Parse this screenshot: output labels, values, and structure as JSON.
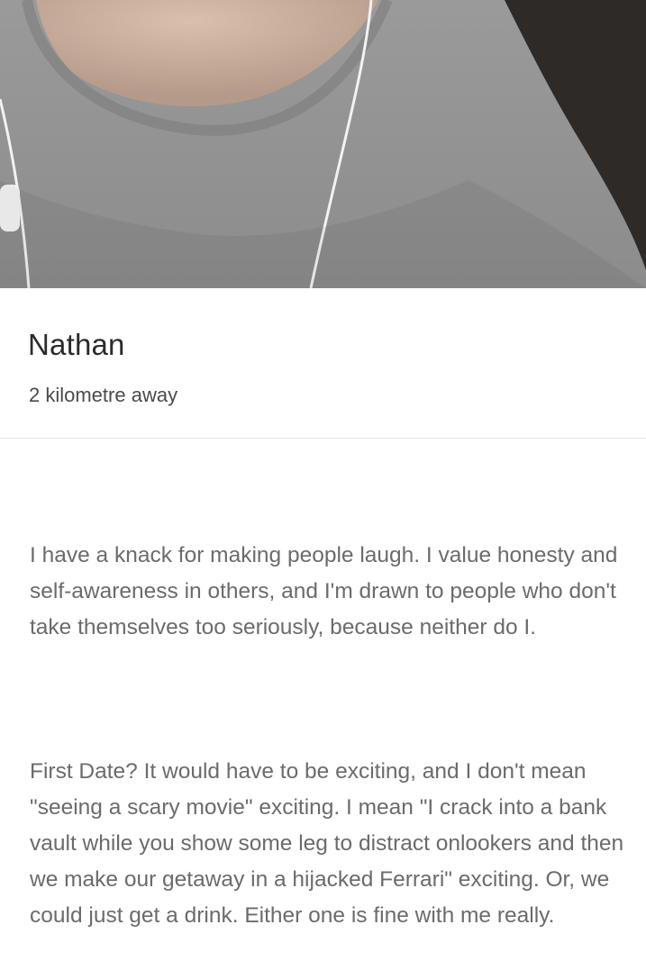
{
  "profile": {
    "photo_description_icon": "profile-photo",
    "name": "Nathan",
    "distance": "2 kilometre away",
    "bio_paragraphs": [
      "I have a knack for making people laugh. I value honesty and self-awareness in others, and I'm drawn to people who don't take themselves too seriously, because neither do I.",
      "First Date? It would have to be exciting, and I don't mean \"seeing a scary movie\" exciting. I mean \"I crack into a bank vault while you show some leg to distract onlookers and then we make our getaway in a hijacked Ferrari\" exciting. Or, we could just get a drink. Either one is fine with me really."
    ]
  },
  "colors": {
    "name_text": "#2b2b2b",
    "distance_text": "#4a4a4a",
    "bio_text": "#6b6b6b",
    "divider": "#e3e3e3",
    "background": "#ffffff"
  }
}
